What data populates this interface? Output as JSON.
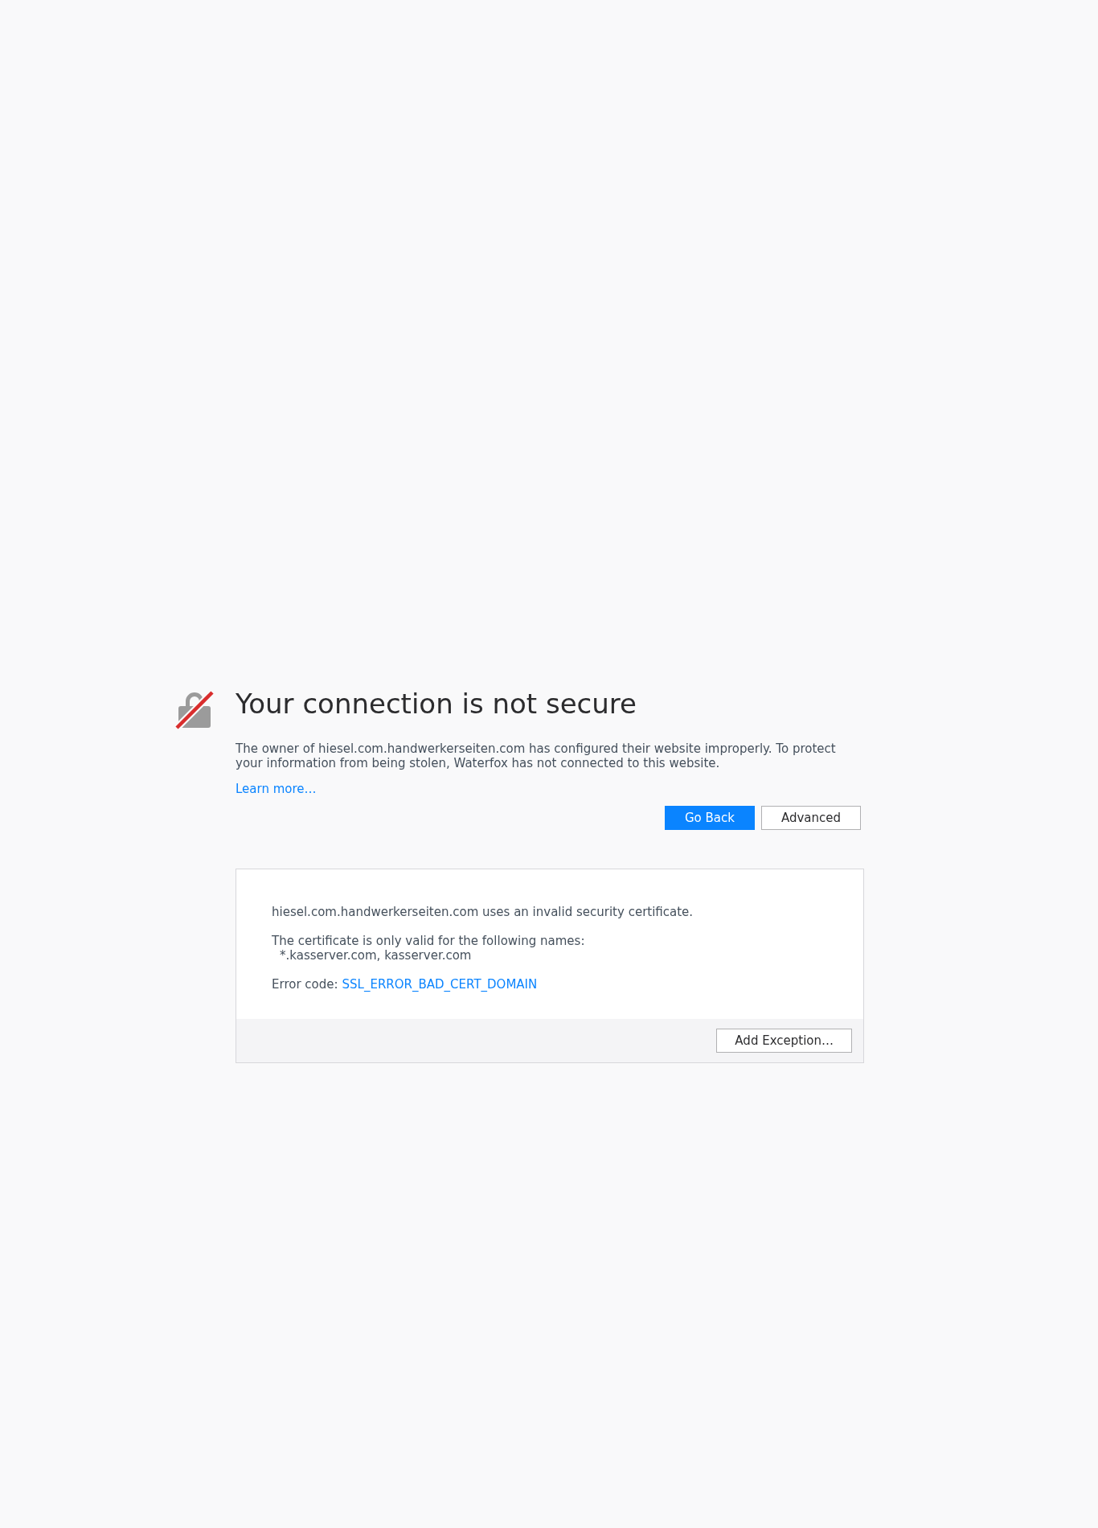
{
  "title": "Your connection is not secure",
  "description": "The owner of hiesel.com.handwerkerseiten.com has configured their website improperly. To protect your information from being stolen, Waterfox has not connected to this website.",
  "learn_more": "Learn more…",
  "buttons": [
    {
      "label": "Go Back",
      "kind": "primary"
    },
    {
      "label": "Advanced",
      "kind": "secondary"
    }
  ],
  "advanced_panel": {
    "message": "hiesel.com.handwerkerseiten.com uses an invalid security certificate.",
    "valid_names_label": "The certificate is only valid for the following names:",
    "valid_names": "*.kasserver.com, kasserver.com",
    "error_code_label": "Error code:",
    "error_code": "SSL_ERROR_BAD_CERT_DOMAIN",
    "footer_button": "Add Exception…"
  }
}
